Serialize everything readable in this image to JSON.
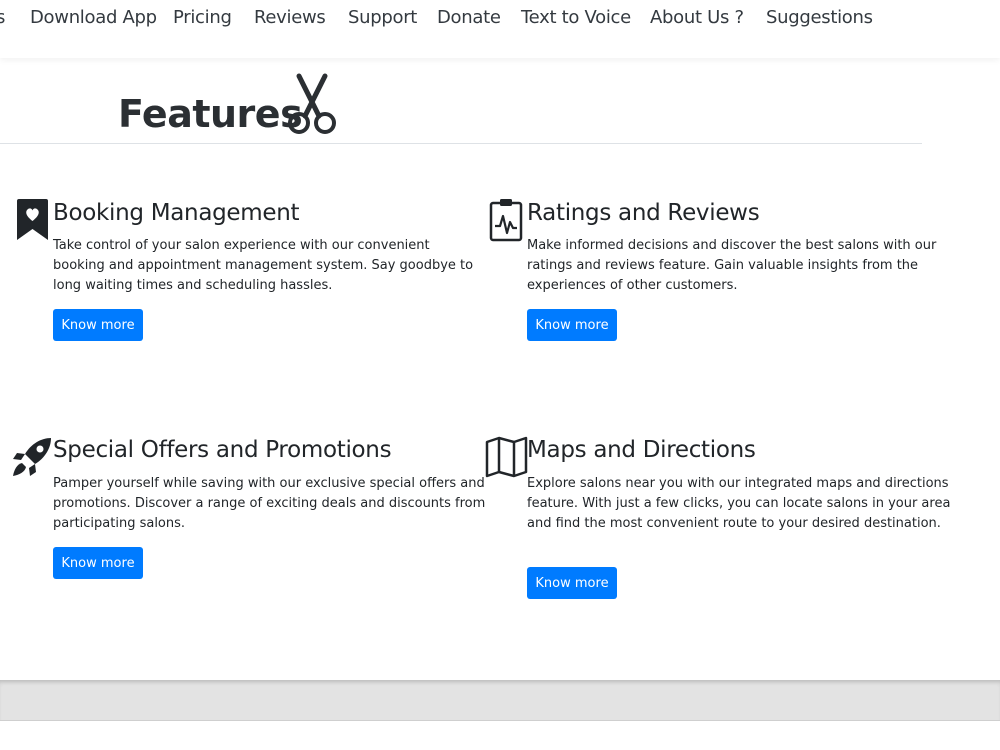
{
  "nav": {
    "items": [
      {
        "label": "s"
      },
      {
        "label": "Download App"
      },
      {
        "label": "Pricing"
      },
      {
        "label": "Reviews"
      },
      {
        "label": "Support"
      },
      {
        "label": "Donate"
      },
      {
        "label": "Text to Voice"
      },
      {
        "label": "About Us ?"
      },
      {
        "label": "Suggestions"
      }
    ]
  },
  "section": {
    "title": "Features",
    "icon": "scissors-icon"
  },
  "features": [
    {
      "icon": "bookmark-heart-icon",
      "title": "Booking Management",
      "lines": [
        "Take control of your salon experience with our convenient",
        "booking and appointment management system. Say goodbye to",
        "long waiting times and scheduling hassles."
      ],
      "button": "Know more"
    },
    {
      "icon": "clipboard-pulse-icon",
      "title": "Ratings and Reviews",
      "lines": [
        "Make informed decisions and discover the best salons with our",
        "ratings and reviews feature. Gain valuable insights from the",
        "experiences of other customers."
      ],
      "button": "Know more"
    },
    {
      "icon": "rocket-icon",
      "title": "Special Offers and Promotions",
      "lines": [
        "Pamper yourself while saving with our exclusive special offers and",
        "promotions. Discover a range of exciting deals and discounts from",
        "participating salons."
      ],
      "button": "Know more"
    },
    {
      "icon": "map-icon",
      "title": "Maps and Directions",
      "lines": [
        "Explore salons near you with our integrated maps and directions",
        "feature. With just a few clicks, you can locate salons in your area",
        "and find the most convenient route to your desired destination."
      ],
      "button": "Know more"
    }
  ],
  "colors": {
    "primary_button": "#007bff",
    "text": "#212529",
    "footer_band": "#e3e3e3"
  }
}
